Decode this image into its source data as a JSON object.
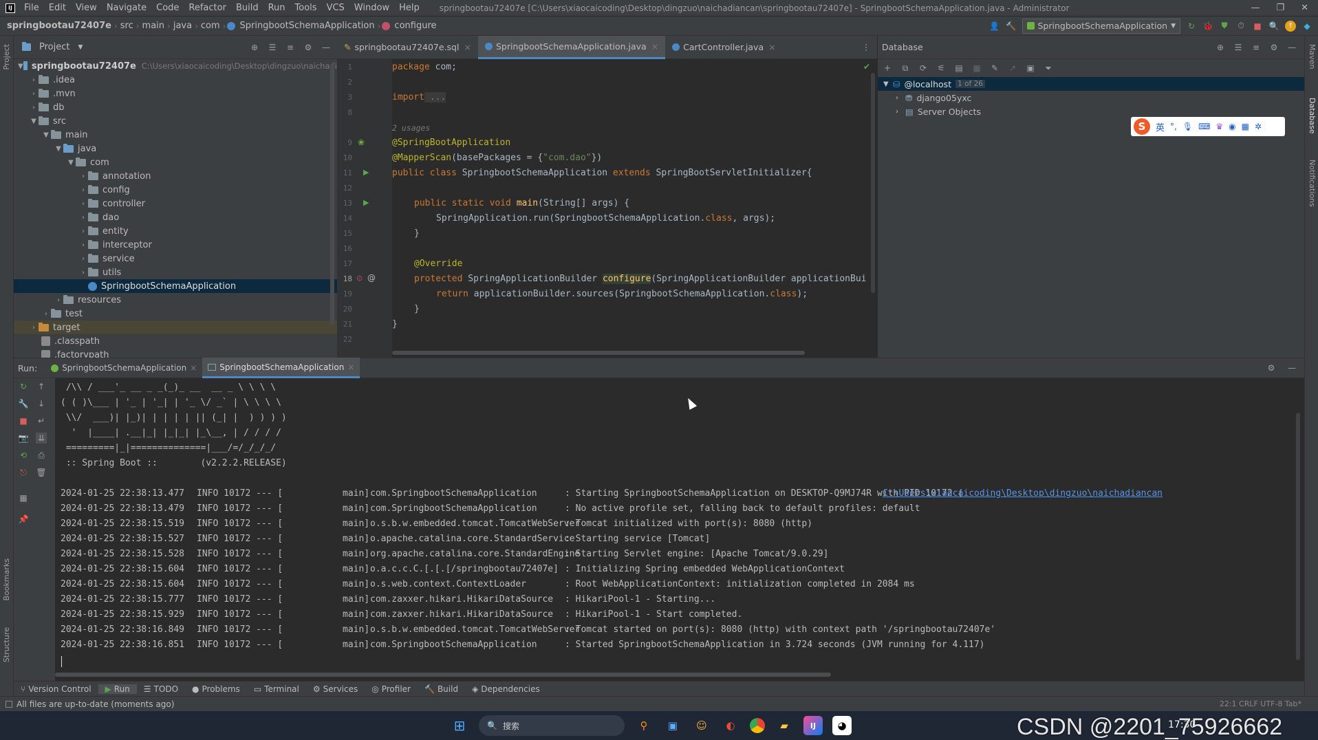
{
  "menu": [
    "File",
    "Edit",
    "View",
    "Navigate",
    "Code",
    "Refactor",
    "Build",
    "Run",
    "Tools",
    "VCS",
    "Window",
    "Help"
  ],
  "window_title": "springbootau72407e [C:\\Users\\xiaocaicoding\\Desktop\\dingzuo\\naichadiancan\\springbootau72407e] - SpringbootSchemaApplication.java - Administrator",
  "breadcrumbs": [
    "springbootau72407e",
    "src",
    "main",
    "java",
    "com",
    "SpringbootSchemaApplication",
    "configure"
  ],
  "run_config": "SpringbootSchemaApplication",
  "project_panel": {
    "title": "Project",
    "root_name": "springbootau72407e",
    "root_path": "C:\\Users\\xiaocaicoding\\Desktop\\dingzuo\\naichadi",
    "items": [
      ".idea",
      ".mvn",
      "db",
      "src",
      "main",
      "java",
      "com",
      "annotation",
      "config",
      "controller",
      "dao",
      "entity",
      "interceptor",
      "service",
      "utils",
      "SpringbootSchemaApplication",
      "resources",
      "test",
      "target",
      ".classpath",
      ".factorypath"
    ]
  },
  "editor": {
    "tabs": [
      "springbootau72407e.sql",
      "SpringbootSchemaApplication.java",
      "CartController.java"
    ],
    "line_numbers": [
      "1",
      "2",
      "3",
      "8",
      "",
      "9",
      "10",
      "11",
      "12",
      "13",
      "14",
      "15",
      "16",
      "17",
      "18",
      "19",
      "20",
      "21",
      "22"
    ],
    "code": {
      "l1_kw": "package",
      "l1_rest": " com;",
      "l3_kw": "import",
      "l3_rest": " ...",
      "hint": "2 usages",
      "l9": "@SpringBootApplication",
      "l10_an": "@MapperScan",
      "l10_a": "(basePackages = {",
      "l10_str": "\"com.dao\"",
      "l10_b": "})",
      "l11_kw1": "public class",
      "l11_a": " SpringbootSchemaApplication ",
      "l11_kw2": "extends",
      "l11_b": " SpringBootServletInitializer{",
      "l13_kw": "public static void",
      "l13_fn": " main",
      "l13_rest": "(String[] args) {",
      "l14_a": "SpringApplication.run(SpringbootSchemaApplication.",
      "l14_kw": "class",
      "l14_b": ", args);",
      "l15": "}",
      "l17": "@Override",
      "l18_kw": "protected",
      "l18_a": " SpringApplicationBuilder ",
      "l18_fn": "configure",
      "l18_b": "(SpringApplicationBuilder applicationBui",
      "l19_kw": "return",
      "l19_a": " applicationBuilder.sources(SpringbootSchemaApplication.",
      "l19_kw2": "class",
      "l19_b": ");",
      "l20": "}",
      "l21": "}"
    }
  },
  "database": {
    "title": "Database",
    "host": "@localhost",
    "host_badge": "1 of 26",
    "children": [
      "django05yxc",
      "Server Objects"
    ]
  },
  "ime_label": "英",
  "run": {
    "label": "Run:",
    "tabs": [
      "SpringbootSchemaApplication",
      "SpringbootSchemaApplication"
    ]
  },
  "console": {
    "banner": [
      " /\\\\ / ___'_ __ _ _(_)_ __  __ _ \\ \\ \\ \\",
      "( ( )\\___ | '_ | '_| | '_ \\/ _` | \\ \\ \\ \\",
      " \\\\/  ___)| |_)| | | | | || (_| |  ) ) ) )",
      "  '  |____| .__|_| |_|_| |_\\__, | / / / /",
      " =========|_|==============|___/=/_/_/_/",
      " :: Spring Boot ::        (v2.2.2.RELEASE)"
    ],
    "logs": [
      {
        "ts": "2024-01-25 22:38:13.477",
        "lvl": "INFO 10172 --- [",
        "thread": "main]",
        "logger": "com.SpringbootSchemaApplication",
        "msg": ": Starting SpringbootSchemaApplication on DESKTOP-Q9MJ74R with PID 10172 (",
        "link": "C:\\Users\\xiaocaicoding\\Desktop\\dingzuo\\naichadiancan"
      },
      {
        "ts": "2024-01-25 22:38:13.479",
        "lvl": "INFO 10172 --- [",
        "thread": "main]",
        "logger": "com.SpringbootSchemaApplication",
        "msg": ": No active profile set, falling back to default profiles: default",
        "link": ""
      },
      {
        "ts": "2024-01-25 22:38:15.519",
        "lvl": "INFO 10172 --- [",
        "thread": "main]",
        "logger": "o.s.b.w.embedded.tomcat.TomcatWebServer",
        "msg": ": Tomcat initialized with port(s): 8080 (http)",
        "link": ""
      },
      {
        "ts": "2024-01-25 22:38:15.527",
        "lvl": "INFO 10172 --- [",
        "thread": "main]",
        "logger": "o.apache.catalina.core.StandardService",
        "msg": ": Starting service [Tomcat]",
        "link": ""
      },
      {
        "ts": "2024-01-25 22:38:15.528",
        "lvl": "INFO 10172 --- [",
        "thread": "main]",
        "logger": "org.apache.catalina.core.StandardEngine",
        "msg": ": Starting Servlet engine: [Apache Tomcat/9.0.29]",
        "link": ""
      },
      {
        "ts": "2024-01-25 22:38:15.604",
        "lvl": "INFO 10172 --- [",
        "thread": "main]",
        "logger": "o.a.c.c.C.[.[.[/springbootau72407e]",
        "msg": ": Initializing Spring embedded WebApplicationContext",
        "link": ""
      },
      {
        "ts": "2024-01-25 22:38:15.604",
        "lvl": "INFO 10172 --- [",
        "thread": "main]",
        "logger": "o.s.web.context.ContextLoader",
        "msg": ": Root WebApplicationContext: initialization completed in 2084 ms",
        "link": ""
      },
      {
        "ts": "2024-01-25 22:38:15.777",
        "lvl": "INFO 10172 --- [",
        "thread": "main]",
        "logger": "com.zaxxer.hikari.HikariDataSource",
        "msg": ": HikariPool-1 - Starting...",
        "link": ""
      },
      {
        "ts": "2024-01-25 22:38:15.929",
        "lvl": "INFO 10172 --- [",
        "thread": "main]",
        "logger": "com.zaxxer.hikari.HikariDataSource",
        "msg": ": HikariPool-1 - Start completed.",
        "link": ""
      },
      {
        "ts": "2024-01-25 22:38:16.849",
        "lvl": "INFO 10172 --- [",
        "thread": "main]",
        "logger": "o.s.b.w.embedded.tomcat.TomcatWebServer",
        "msg": ": Tomcat started on port(s): 8080 (http) with context path '/springbootau72407e'",
        "link": ""
      },
      {
        "ts": "2024-01-25 22:38:16.851",
        "lvl": "INFO 10172 --- [",
        "thread": "main]",
        "logger": "com.SpringbootSchemaApplication",
        "msg": ": Started SpringbootSchemaApplication in 3.724 seconds (JVM running for 4.117)",
        "link": ""
      }
    ]
  },
  "bottom_tabs": [
    "Version Control",
    "Run",
    "TODO",
    "Problems",
    "Terminal",
    "Services",
    "Profiler",
    "Build",
    "Dependencies"
  ],
  "status": {
    "message": "All files are up-to-date (moments ago)",
    "right": "22:1  CRLF  UTF-8  Tab*"
  },
  "side_labels": {
    "project": "Project",
    "bookmarks": "Bookmarks",
    "structure": "Structure",
    "maven": "Maven",
    "database": "Database",
    "notifications": "Notifications"
  },
  "taskbar": {
    "search": "搜索",
    "time": "17:30",
    "watermark": "CSDN @2201_75926662"
  }
}
